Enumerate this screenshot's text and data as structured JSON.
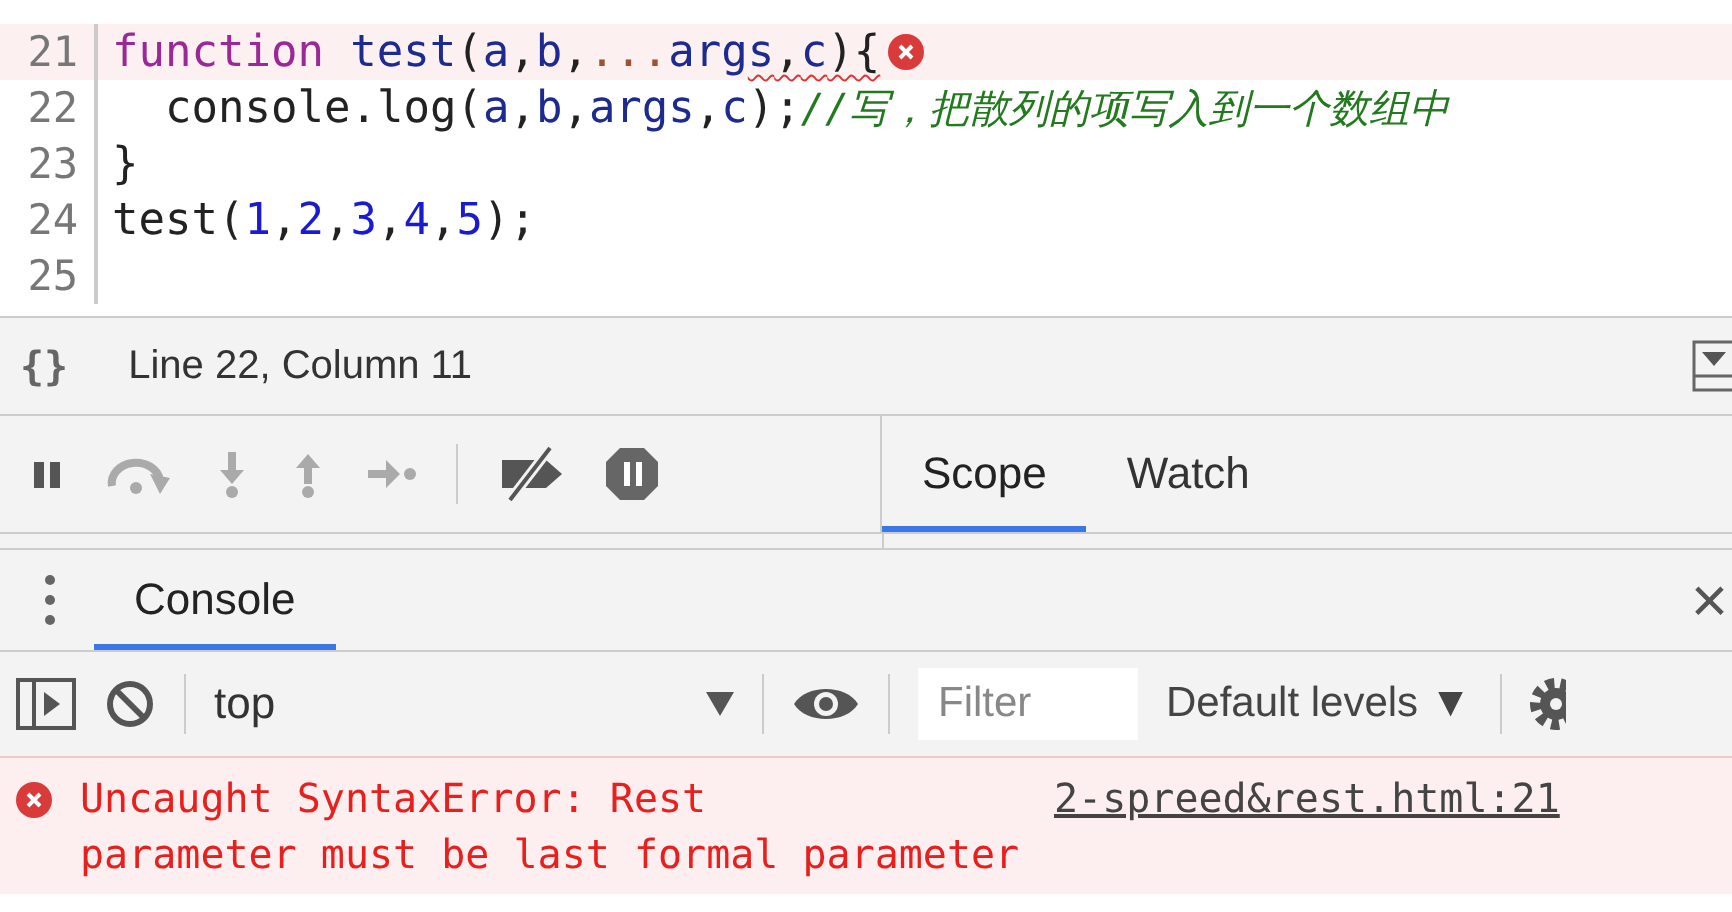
{
  "editor": {
    "lines": [
      {
        "number": "21",
        "error": true,
        "tokens": [
          {
            "kind": "keyword",
            "text": "function"
          },
          {
            "kind": "def",
            "text": "test",
            "space_before": true
          },
          {
            "kind": "plain",
            "text": "("
          },
          {
            "kind": "var",
            "text": "a"
          },
          {
            "kind": "plain",
            "text": ","
          },
          {
            "kind": "var",
            "text": "b"
          },
          {
            "kind": "plain",
            "text": ","
          },
          {
            "kind": "operator",
            "text": "..."
          },
          {
            "kind": "var",
            "text": "arg"
          },
          {
            "kind": "var",
            "text": "s",
            "squiggle": true
          },
          {
            "kind": "plain",
            "text": ",",
            "squiggle": true
          },
          {
            "kind": "var",
            "text": "c",
            "squiggle": true
          },
          {
            "kind": "plain",
            "text": "){",
            "squiggle": true
          }
        ]
      },
      {
        "number": "22",
        "error": false,
        "tokens": [
          {
            "kind": "plain",
            "text": "  console.log("
          },
          {
            "kind": "var",
            "text": "a"
          },
          {
            "kind": "plain",
            "text": ","
          },
          {
            "kind": "var",
            "text": "b"
          },
          {
            "kind": "plain",
            "text": ","
          },
          {
            "kind": "var",
            "text": "args"
          },
          {
            "kind": "plain",
            "text": ","
          },
          {
            "kind": "var",
            "text": "c"
          },
          {
            "kind": "plain",
            "text": ");"
          },
          {
            "kind": "comment",
            "text": "//写，把散列的项写入到一个数组中"
          }
        ]
      },
      {
        "number": "23",
        "error": false,
        "tokens": [
          {
            "kind": "plain",
            "text": "}"
          }
        ]
      },
      {
        "number": "24",
        "error": false,
        "tokens": [
          {
            "kind": "plain",
            "text": "test("
          },
          {
            "kind": "number",
            "text": "1"
          },
          {
            "kind": "plain",
            "text": ","
          },
          {
            "kind": "number",
            "text": "2"
          },
          {
            "kind": "plain",
            "text": ","
          },
          {
            "kind": "number",
            "text": "3"
          },
          {
            "kind": "plain",
            "text": ","
          },
          {
            "kind": "number",
            "text": "4"
          },
          {
            "kind": "plain",
            "text": ","
          },
          {
            "kind": "number",
            "text": "5"
          },
          {
            "kind": "plain",
            "text": ");"
          }
        ]
      },
      {
        "number": "25",
        "error": false
      }
    ]
  },
  "status_bar": {
    "format_icon": "{}",
    "position": "Line 22, Column 11"
  },
  "debugger": {
    "sidebar_tabs": [
      {
        "label": "Scope",
        "selected": true
      },
      {
        "label": "Watch",
        "selected": false
      }
    ]
  },
  "drawer": {
    "tabs": [
      {
        "label": "Console",
        "selected": true
      }
    ],
    "close": "×"
  },
  "console_toolbar": {
    "context": "top",
    "filter": {
      "placeholder": "Filter"
    },
    "levels": "Default levels ▼"
  },
  "messages": [
    {
      "kind": "error",
      "text": "Uncaught SyntaxError: Rest\nparameter must be last formal parameter",
      "source": "2-spreed&rest.html:21"
    }
  ]
}
